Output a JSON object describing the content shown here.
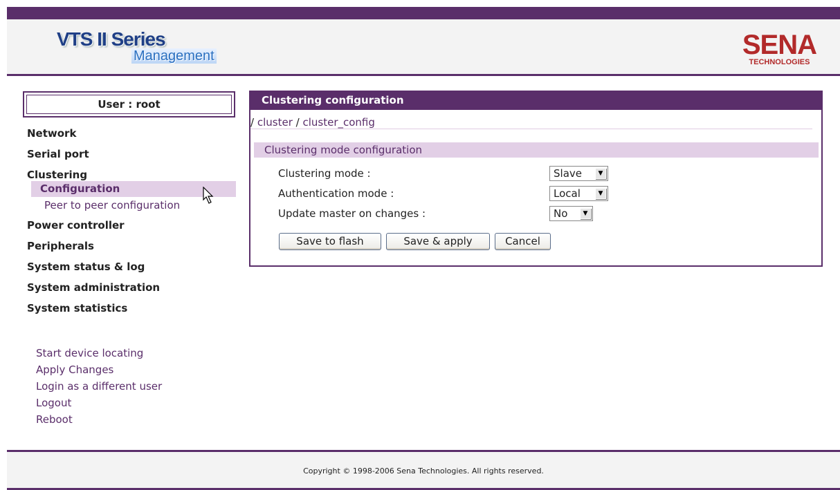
{
  "header": {
    "logo_line1": "VTS II Series",
    "logo_line2": "Management",
    "brand_name": "SENA",
    "brand_tagline": "TECHNOLOGIES"
  },
  "user": {
    "label": "User : root"
  },
  "sidebar": {
    "items": [
      {
        "label": "Network"
      },
      {
        "label": "Serial port"
      },
      {
        "label": "Clustering"
      },
      {
        "label": "Power controller"
      },
      {
        "label": "Peripherals"
      },
      {
        "label": "System status & log"
      },
      {
        "label": "System administration"
      },
      {
        "label": "System statistics"
      }
    ],
    "clustering_sub": [
      {
        "label": "Configuration"
      },
      {
        "label": "Peer to peer configuration"
      }
    ],
    "actions": [
      {
        "label": "Start device locating"
      },
      {
        "label": "Apply Changes"
      },
      {
        "label": "Login as a different user"
      },
      {
        "label": "Logout"
      },
      {
        "label": "Reboot"
      }
    ]
  },
  "panel": {
    "title": "Clustering configuration",
    "breadcrumb": {
      "sep": "/",
      "part1": "cluster",
      "part2": "cluster_config"
    },
    "section_title": "Clustering mode configuration",
    "fields": [
      {
        "label": "Clustering mode :",
        "value": "Slave"
      },
      {
        "label": "Authentication mode :",
        "value": "Local"
      },
      {
        "label": "Update master on changes :",
        "value": "No"
      }
    ],
    "buttons": {
      "save_flash": "Save to flash",
      "save_apply": "Save & apply",
      "cancel": "Cancel"
    }
  },
  "footer": {
    "copyright": "Copyright © 1998-2006 Sena Technologies. All rights reserved."
  },
  "colors": {
    "accent": "#5a2e6a",
    "highlight": "#e2cfe6",
    "brand_red": "#b22a2a"
  }
}
